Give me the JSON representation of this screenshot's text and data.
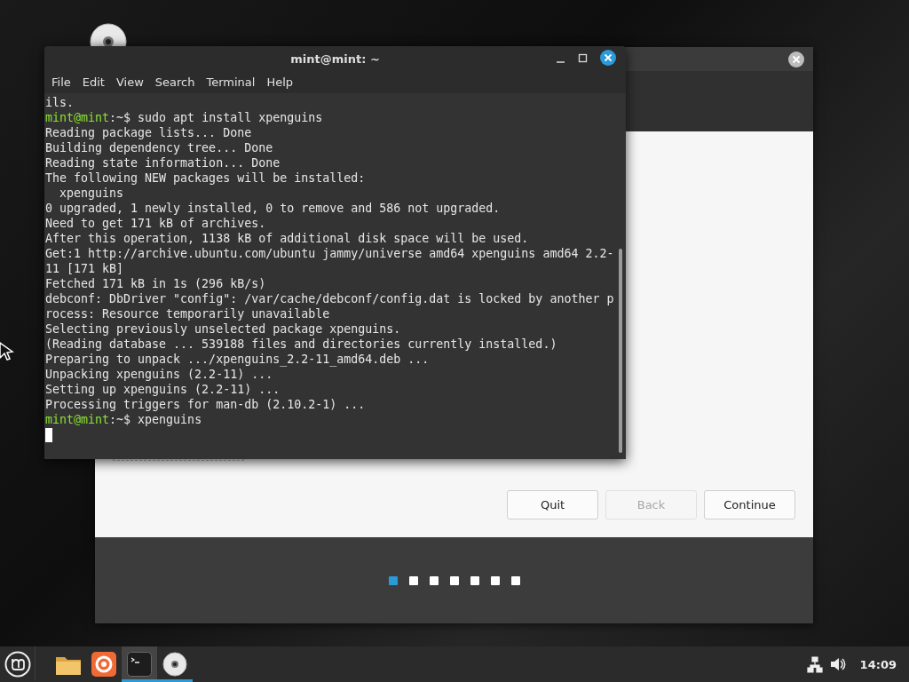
{
  "desktop": {
    "icons": [
      {
        "kind": "disc"
      }
    ]
  },
  "installer": {
    "buttons": [
      {
        "label": "Quit",
        "disabled": false
      },
      {
        "label": "Back",
        "disabled": true
      },
      {
        "label": "Continue",
        "disabled": false
      }
    ],
    "steps": [
      {
        "selected": true
      },
      {
        "selected": false
      },
      {
        "selected": false
      },
      {
        "selected": false
      },
      {
        "selected": false
      },
      {
        "selected": false
      },
      {
        "selected": false
      }
    ]
  },
  "terminal": {
    "title": "mint@mint: ~",
    "menu": [
      "File",
      "Edit",
      "View",
      "Search",
      "Terminal",
      "Help"
    ],
    "lines": [
      {
        "kind": "output",
        "text": "ils."
      },
      {
        "kind": "prompt",
        "user": "mint@mint",
        "text": ":~$ sudo apt install xpenguins"
      },
      {
        "kind": "output",
        "text": "Reading package lists... Done"
      },
      {
        "kind": "output",
        "text": "Building dependency tree... Done"
      },
      {
        "kind": "output",
        "text": "Reading state information... Done"
      },
      {
        "kind": "output",
        "text": "The following NEW packages will be installed:"
      },
      {
        "kind": "output",
        "text": "  xpenguins"
      },
      {
        "kind": "output",
        "text": "0 upgraded, 1 newly installed, 0 to remove and 586 not upgraded."
      },
      {
        "kind": "output",
        "text": "Need to get 171 kB of archives."
      },
      {
        "kind": "output",
        "text": "After this operation, 1138 kB of additional disk space will be used."
      },
      {
        "kind": "output",
        "text": "Get:1 http://archive.ubuntu.com/ubuntu jammy/universe amd64 xpenguins amd64 2.2-"
      },
      {
        "kind": "output",
        "text": "11 [171 kB]"
      },
      {
        "kind": "output",
        "text": "Fetched 171 kB in 1s (296 kB/s)"
      },
      {
        "kind": "output",
        "text": "debconf: DbDriver \"config\": /var/cache/debconf/config.dat is locked by another p"
      },
      {
        "kind": "output",
        "text": "rocess: Resource temporarily unavailable"
      },
      {
        "kind": "output",
        "text": "Selecting previously unselected package xpenguins."
      },
      {
        "kind": "output",
        "text": "(Reading database ... 539188 files and directories currently installed.)"
      },
      {
        "kind": "output",
        "text": "Preparing to unpack .../xpenguins_2.2-11_amd64.deb ..."
      },
      {
        "kind": "output",
        "text": "Unpacking xpenguins (2.2-11) ..."
      },
      {
        "kind": "output",
        "text": "Setting up xpenguins (2.2-11) ..."
      },
      {
        "kind": "output",
        "text": "Processing triggers for man-db (2.10.2-1) ..."
      },
      {
        "kind": "prompt",
        "user": "mint@mint",
        "text": ":~$ xpenguins"
      },
      {
        "kind": "cursor"
      }
    ]
  },
  "taskbar": {
    "apps": [
      {
        "kind": "menu",
        "running": false,
        "focused": false
      },
      {
        "kind": "folder",
        "running": false,
        "focused": false
      },
      {
        "kind": "browser",
        "running": false,
        "focused": false
      },
      {
        "kind": "terminal",
        "running": true,
        "focused": true
      },
      {
        "kind": "disc",
        "running": true,
        "focused": false
      }
    ],
    "tray": [
      {
        "kind": "network"
      },
      {
        "kind": "volume"
      }
    ],
    "clock": "14:09"
  }
}
